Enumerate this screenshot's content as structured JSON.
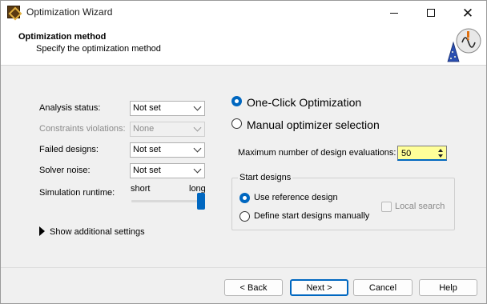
{
  "window": {
    "title": "Optimization Wizard",
    "minimize_icon": "minimize-icon",
    "maximize_icon": "maximize-icon",
    "close_icon": "close-icon"
  },
  "header": {
    "title": "Optimization method",
    "subtitle": "Specify the optimization method",
    "icon": "wizard-hat-icon"
  },
  "settings": [
    {
      "label": "Analysis status:",
      "value": "Not set",
      "enabled": true
    },
    {
      "label": "Constraints violations:",
      "value": "None",
      "enabled": false
    },
    {
      "label": "Failed designs:",
      "value": "Not set",
      "enabled": true
    },
    {
      "label": "Solver noise:",
      "value": "Not set",
      "enabled": true
    }
  ],
  "runtime": {
    "label": "Simulation runtime:",
    "min_label": "short",
    "max_label": "long",
    "level": 1.0
  },
  "expander": {
    "label": "Show additional settings",
    "expanded": false
  },
  "method": {
    "options": [
      {
        "label": "One-Click Optimization",
        "selected": true
      },
      {
        "label": "Manual optimizer selection",
        "selected": false
      }
    ]
  },
  "evaluations": {
    "label": "Maximum number of design evaluations:",
    "value": "50"
  },
  "start_designs": {
    "title": "Start designs",
    "options": [
      {
        "label": "Use reference design",
        "selected": true
      },
      {
        "label": "Define start designs manually",
        "selected": false
      }
    ],
    "local_search_label": "Local search",
    "local_search_checked": false,
    "local_search_enabled": false
  },
  "buttons": {
    "back": "< Back",
    "next": "Next >",
    "cancel": "Cancel",
    "help": "Help"
  },
  "colors": {
    "accent": "#0067c0",
    "spin_bg": "#ffff99"
  }
}
